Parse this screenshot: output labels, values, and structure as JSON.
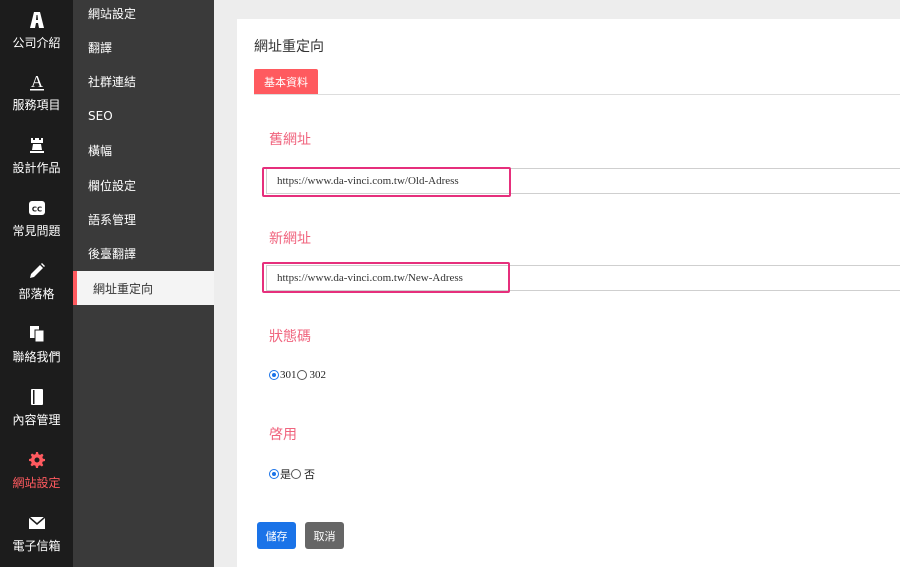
{
  "rail": {
    "items": [
      {
        "label": "公司介紹",
        "icon": "company-icon"
      },
      {
        "label": "服務項目",
        "icon": "service-icon"
      },
      {
        "label": "設計作品",
        "icon": "portfolio-icon"
      },
      {
        "label": "常見問題",
        "icon": "faq-icon"
      },
      {
        "label": "部落格",
        "icon": "blog-pencil-icon"
      },
      {
        "label": "聯絡我們",
        "icon": "contact-icon"
      },
      {
        "label": "內容管理",
        "icon": "content-book-icon"
      },
      {
        "label": "網站設定",
        "icon": "gear-icon",
        "active": true
      },
      {
        "label": "電子信箱",
        "icon": "envelope-icon"
      }
    ],
    "active_color": "#ff5a5f"
  },
  "submenu": {
    "items": [
      {
        "label": "網站設定"
      },
      {
        "label": "翻譯"
      },
      {
        "label": "社群連結"
      },
      {
        "label": "SEO"
      },
      {
        "label": "橫幅"
      },
      {
        "label": "欄位設定"
      },
      {
        "label": "語系管理"
      },
      {
        "label": "後臺翻譯"
      },
      {
        "label": "網址重定向",
        "active": true
      }
    ]
  },
  "main": {
    "title": "網址重定向",
    "tab_label": "基本資料",
    "old_url": {
      "label": "舊網址",
      "value": "https://www.da-vinci.com.tw/Old-Adress"
    },
    "new_url": {
      "label": "新網址",
      "value": "https://www.da-vinci.com.tw/New-Adress"
    },
    "status_code": {
      "label": "狀態碼",
      "options": [
        "301",
        "302"
      ],
      "selected": "301"
    },
    "enabled": {
      "label": "啓用",
      "options": [
        "是",
        "否"
      ],
      "selected": "是"
    },
    "save_label": "儲存",
    "cancel_label": "取消"
  },
  "colors": {
    "accent": "#ff5a5f",
    "label_pink": "#f0647e",
    "highlight": "#e62f7c",
    "primary": "#1a73e8"
  }
}
